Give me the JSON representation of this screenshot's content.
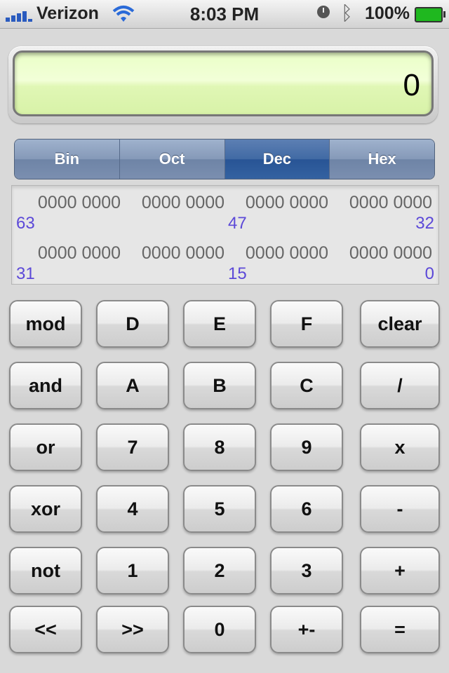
{
  "status_bar": {
    "carrier": "Verizon",
    "time": "8:03 PM",
    "battery_percent": "100%",
    "icons": [
      "signal-icon",
      "wifi-icon",
      "clock-icon",
      "bluetooth-icon",
      "battery-icon"
    ]
  },
  "display": {
    "value": "0"
  },
  "modes": {
    "active": "Dec",
    "bin": "Bin",
    "oct": "Oct",
    "dec": "Dec",
    "hex": "Hex"
  },
  "bits": {
    "row1": {
      "groups": [
        "0000 0000",
        "0000 0000",
        "0000 0000",
        "0000 0000"
      ],
      "pos_left": "63",
      "pos_mid": "47",
      "pos_right": "32"
    },
    "row2": {
      "groups": [
        "0000 0000",
        "0000 0000",
        "0000 0000",
        "0000 0000"
      ],
      "pos_left": "31",
      "pos_mid": "15",
      "pos_right": "0"
    }
  },
  "keys": [
    [
      "mod",
      "D",
      "E",
      "F",
      "clear"
    ],
    [
      "and",
      "A",
      "B",
      "C",
      "/"
    ],
    [
      "or",
      "7",
      "8",
      "9",
      "x"
    ],
    [
      "xor",
      "4",
      "5",
      "6",
      "-"
    ],
    [
      "not",
      "1",
      "2",
      "3",
      "+"
    ],
    [
      "<<",
      ">>",
      "0",
      "+-",
      "="
    ]
  ],
  "colors": {
    "lcd": "#eaffc7",
    "segment_active": "#3a64a0",
    "bit_position": "#5c49d8"
  }
}
